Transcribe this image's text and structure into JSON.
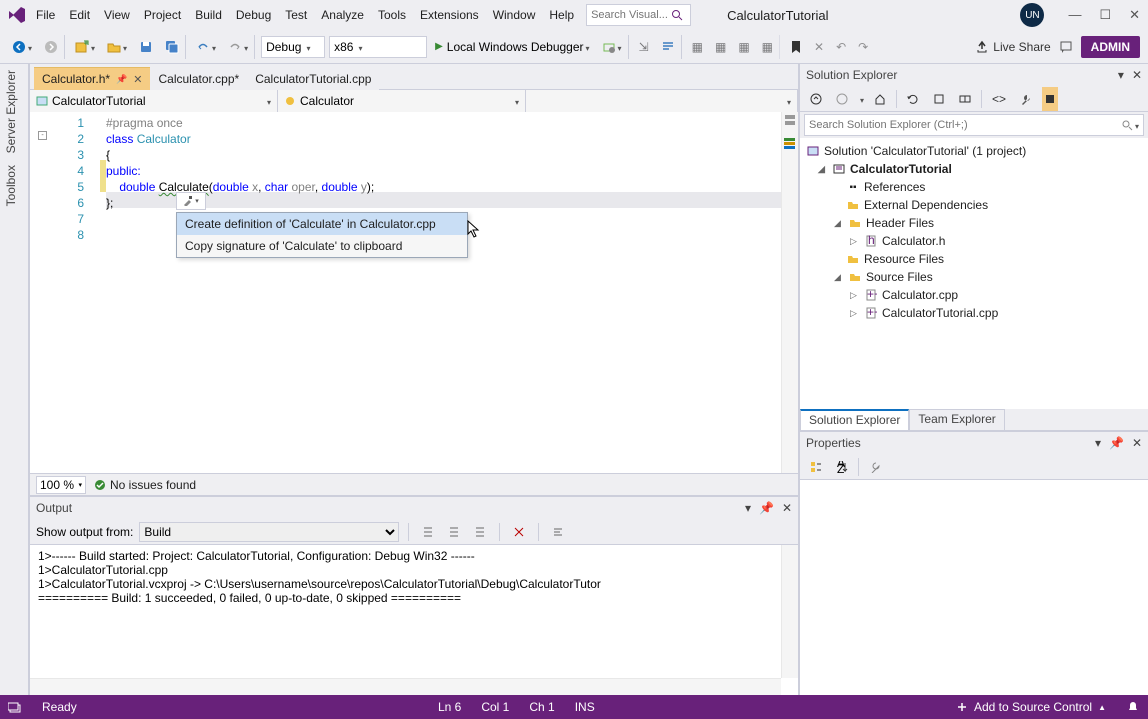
{
  "titlebar": {
    "menu": [
      "File",
      "Edit",
      "View",
      "Project",
      "Build",
      "Debug",
      "Test",
      "Analyze",
      "Tools",
      "Extensions",
      "Window",
      "Help"
    ],
    "search_placeholder": "Search Visual...",
    "solution_title": "CalculatorTutorial",
    "avatar_initials": "UN",
    "win_min": "—",
    "win_max": "☐",
    "win_close": "✕"
  },
  "toolbar": {
    "config": "Debug",
    "platform": "x86",
    "debug_target": "Local Windows Debugger",
    "live_share": "Live Share",
    "admin": "ADMIN"
  },
  "editor": {
    "tabs": [
      {
        "label": "Calculator.h*",
        "active": true,
        "pinned": true
      },
      {
        "label": "Calculator.cpp*",
        "active": false,
        "pinned": false
      },
      {
        "label": "CalculatorTutorial.cpp",
        "active": false,
        "pinned": false
      }
    ],
    "nav_scope": "CalculatorTutorial",
    "nav_class": "Calculator",
    "code_lines": {
      "l1": "#pragma once",
      "l2a": "class ",
      "l2b": "Calculator",
      "l3": "{",
      "l4": "public:",
      "l5a": "    double ",
      "l5b": "Calculate",
      "l5c": "(",
      "l5d": "double ",
      "l5e": "x",
      "l5f": ", ",
      "l5g": "char ",
      "l5h": "oper",
      "l5i": ", ",
      "l5j": "double ",
      "l5k": "y",
      "l5l": ");",
      "l6": "};"
    },
    "line_numbers": [
      "1",
      "2",
      "3",
      "4",
      "5",
      "6",
      "7",
      "8"
    ],
    "context_menu": {
      "item1": "Create definition of 'Calculate' in Calculator.cpp",
      "item2": "Copy signature of 'Calculate' to clipboard"
    },
    "zoom": "100 %",
    "issues_text": "No issues found"
  },
  "output": {
    "title": "Output",
    "from_label": "Show output from:",
    "from_value": "Build",
    "text": "1>------ Build started: Project: CalculatorTutorial, Configuration: Debug Win32 ------\n1>CalculatorTutorial.cpp\n1>CalculatorTutorial.vcxproj -> C:\\Users\\username\\source\\repos\\CalculatorTutorial\\Debug\\CalculatorTutor\n========== Build: 1 succeeded, 0 failed, 0 up-to-date, 0 skipped =========="
  },
  "solution_explorer": {
    "title": "Solution Explorer",
    "search_placeholder": "Search Solution Explorer (Ctrl+;)",
    "root": "Solution 'CalculatorTutorial' (1 project)",
    "project": "CalculatorTutorial",
    "nodes": {
      "references": "References",
      "external": "External Dependencies",
      "header_files": "Header Files",
      "calculator_h": "Calculator.h",
      "resource_files": "Resource Files",
      "source_files": "Source Files",
      "calculator_cpp": "Calculator.cpp",
      "tutorial_cpp": "CalculatorTutorial.cpp"
    },
    "tab_se": "Solution Explorer",
    "tab_te": "Team Explorer"
  },
  "properties": {
    "title": "Properties"
  },
  "side_tabs": {
    "server": "Server Explorer",
    "toolbox": "Toolbox"
  },
  "statusbar": {
    "ready": "Ready",
    "ln": "Ln 6",
    "col": "Col 1",
    "ch": "Ch 1",
    "ins": "INS",
    "add_src": "Add to Source Control"
  }
}
